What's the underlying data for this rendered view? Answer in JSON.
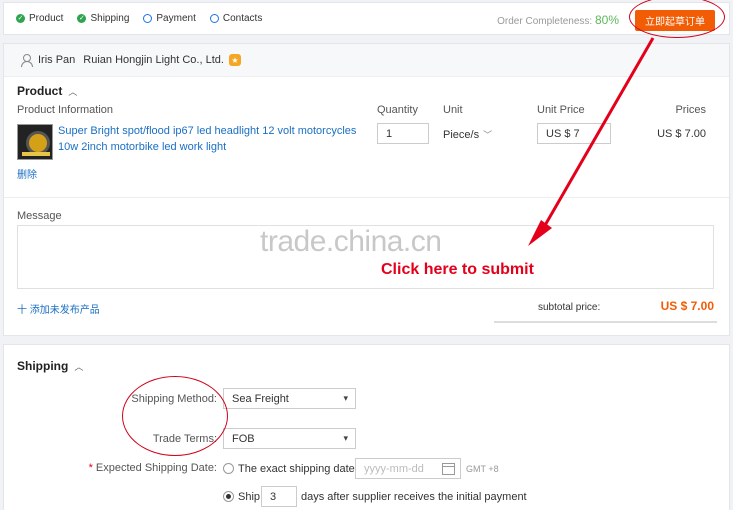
{
  "steps": [
    {
      "label": "Product",
      "state": "done"
    },
    {
      "label": "Shipping",
      "state": "done"
    },
    {
      "label": "Payment",
      "state": "todo"
    },
    {
      "label": "Contacts",
      "state": "todo"
    }
  ],
  "completeness": {
    "label": "Order Completeness:",
    "value": "80%"
  },
  "submit_button": "立即起草订单",
  "seller": {
    "name": "Iris Pan",
    "company": "Ruian Hongjin Light Co., Ltd."
  },
  "product": {
    "section_title": "Product",
    "columns": {
      "info": "Product Information",
      "quantity": "Quantity",
      "unit": "Unit",
      "unit_price": "Unit Price",
      "prices": "Prices"
    },
    "name": "Super Bright spot/flood ip67 led headlight 12 volt motorcycles 10w 2inch motorbike led work light",
    "delete_label": "删除",
    "quantity": "1",
    "unit": "Piece/s",
    "unit_price": "US $ 7",
    "price": "US $ 7.00"
  },
  "message": {
    "label": "Message"
  },
  "watermark": "trade.china.cn",
  "callout": "Click here to submit",
  "add_product": "十 添加未发布产品",
  "subtotal": {
    "label": "subtotal price:",
    "value": "US $ 7.00"
  },
  "shipping": {
    "section_title": "Shipping",
    "method_label": "Shipping Method:",
    "method_value": "Sea Freight",
    "terms_label": "Trade Terms:",
    "terms_value": "FOB",
    "date_label": "Expected Shipping Date:",
    "exact_option": "The exact shipping date",
    "date_placeholder": "yyyy-mm-dd",
    "timezone": "GMT +8",
    "ship_option": "Ship",
    "ship_days": "3",
    "ship_suffix": "days after supplier receives the initial payment"
  },
  "colors": {
    "accent": "#f25c05",
    "link": "#1a6fc4",
    "success": "#5cb85c",
    "annotation": "#e4001b"
  }
}
